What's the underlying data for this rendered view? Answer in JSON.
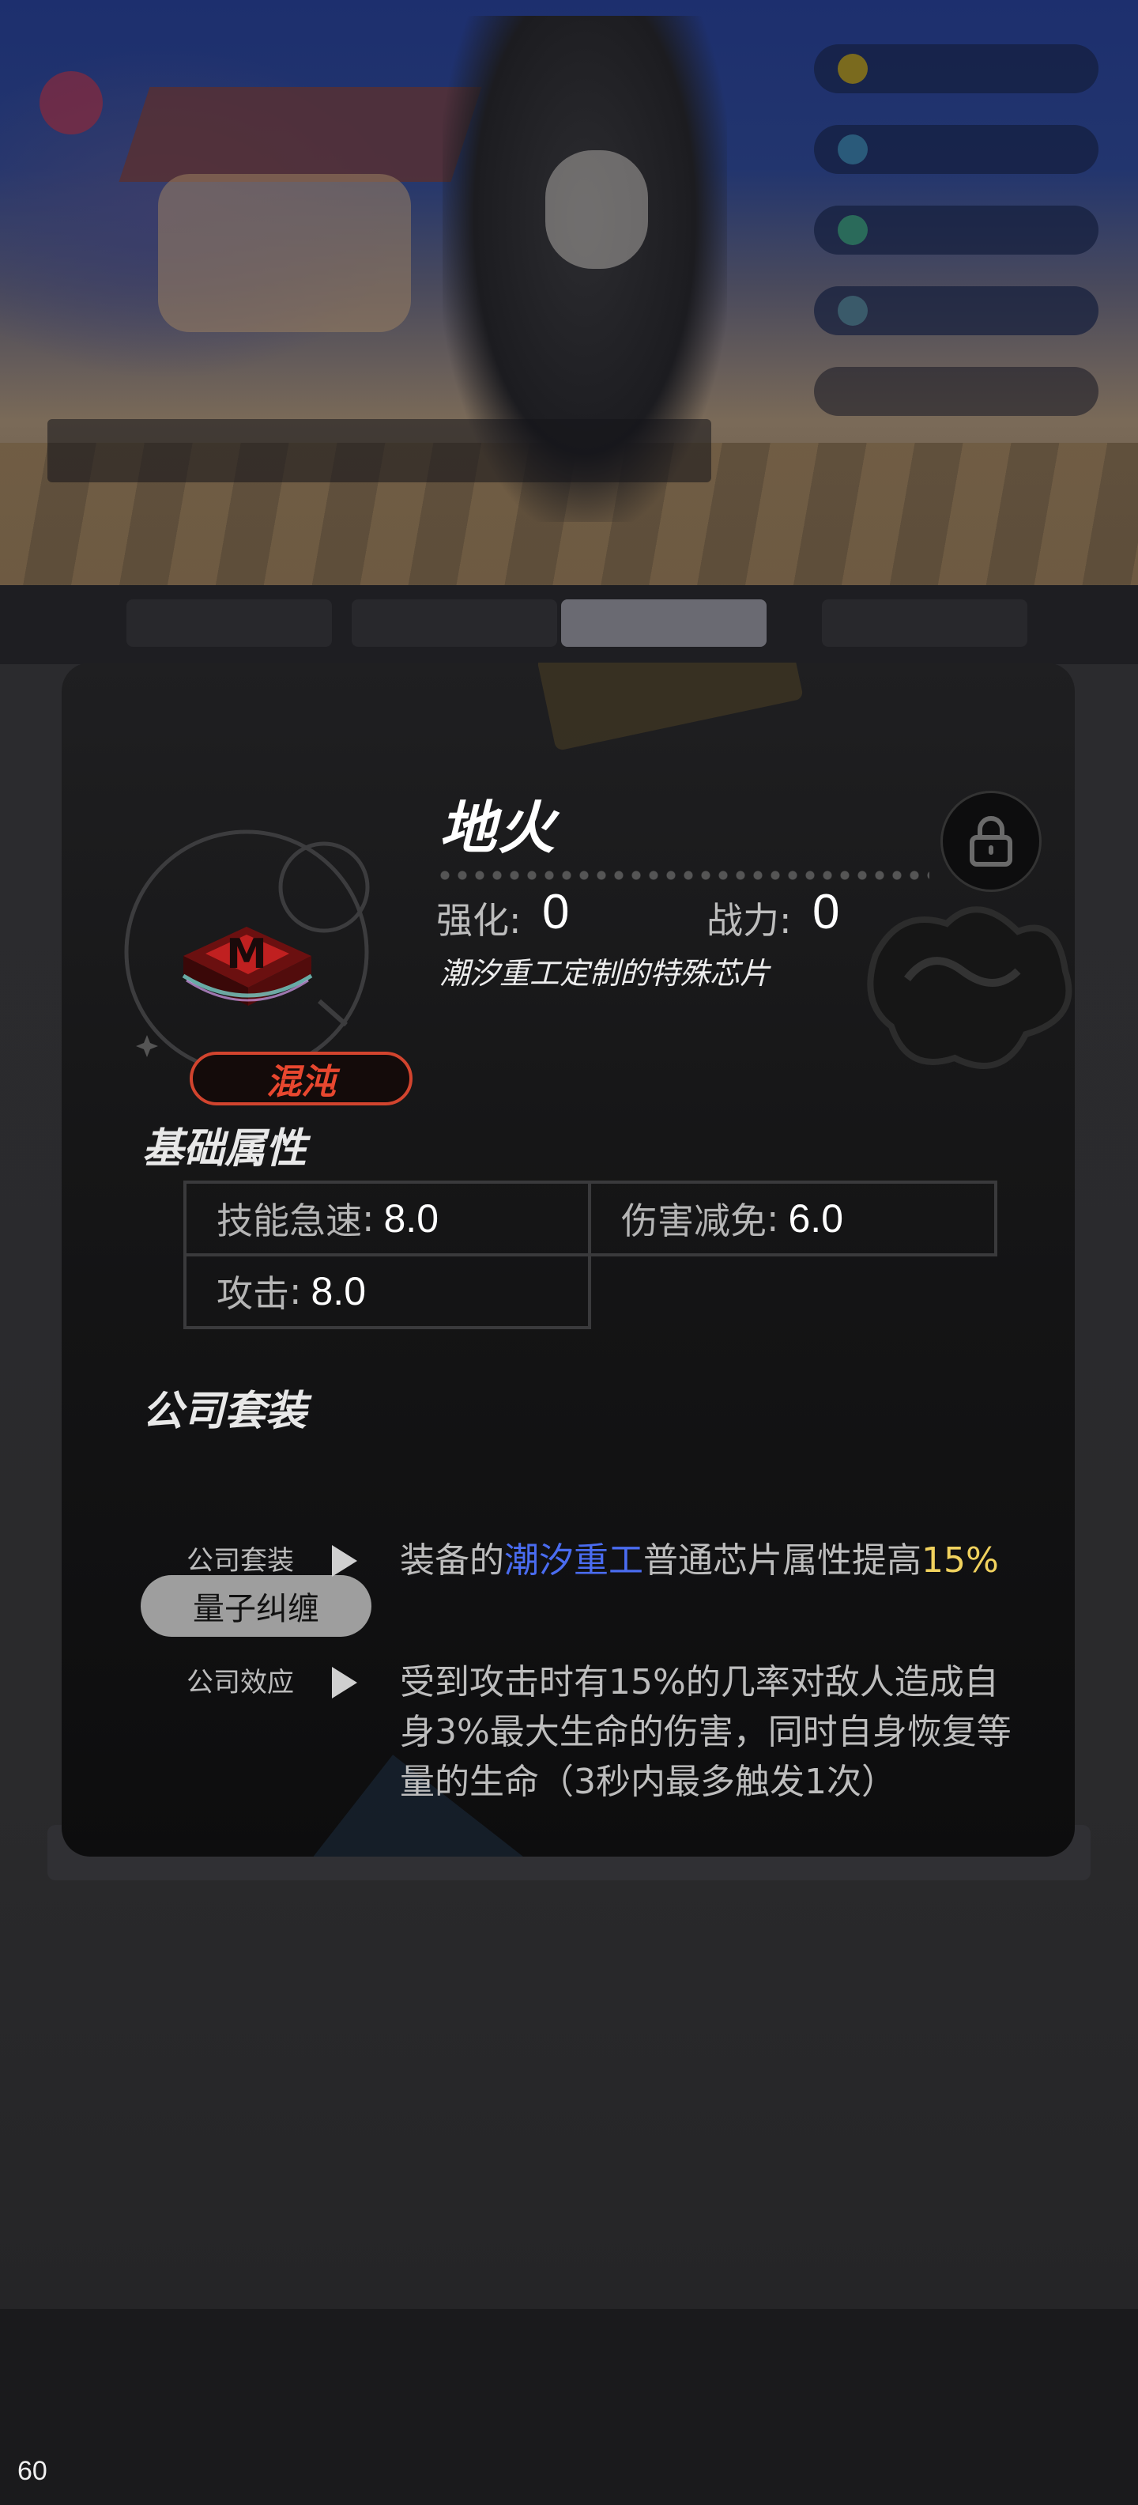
{
  "fps": "60",
  "chip": {
    "name": "地火",
    "enhance_label": "强化",
    "enhance_value": "0",
    "power_label": "战力",
    "power_value": "0",
    "colon": ":",
    "description": "潮汐重工定制的特殊芯片",
    "rarity": "混沌",
    "rarity_color": "#d2442e",
    "lock_icon": "lock-icon"
  },
  "base_attributes": {
    "title": "基础属性",
    "items": [
      {
        "label": "技能急速",
        "value": "8.0"
      },
      {
        "label": "伤害减免",
        "value": "6.0"
      },
      {
        "label": "攻击",
        "value": "8.0"
      }
    ]
  },
  "company_set": {
    "title": "公司套装",
    "set_name": "量子纠缠",
    "effects": [
      {
        "label": "公司套装",
        "text_parts": [
          "装备的",
          "潮汐重工",
          "普通芯片属性提高",
          "15%"
        ]
      },
      {
        "label": "公司效应",
        "text": "受到攻击时有15%的几率对敌人造成自身3%最大生命的伤害，同时自身恢复等量的生命（3秒内最多触发1次）"
      }
    ],
    "highlight_blue": "#4a6cf0",
    "highlight_yellow": "#f1d25e"
  }
}
